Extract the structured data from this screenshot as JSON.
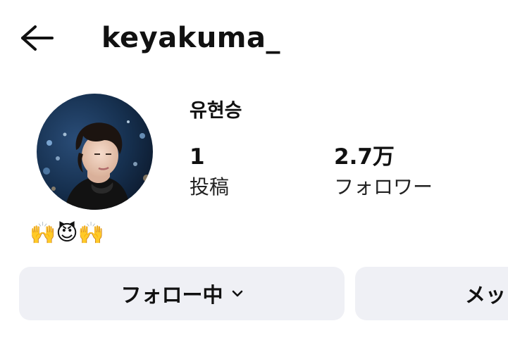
{
  "header": {
    "back_icon": "arrow-left-icon",
    "username": "keyakuma_"
  },
  "profile": {
    "display_name": "유현승",
    "stats": {
      "posts_value": "1",
      "posts_label": "投稿",
      "followers_value": "2.7万",
      "followers_label": "フォロワー"
    },
    "bio": "🙌😈🙌"
  },
  "actions": {
    "follow_label": "フォロー中",
    "follow_icon": "chevron-down-icon",
    "message_label": "メッ"
  },
  "colors": {
    "button_bg": "#eff0f5",
    "text": "#111111"
  }
}
